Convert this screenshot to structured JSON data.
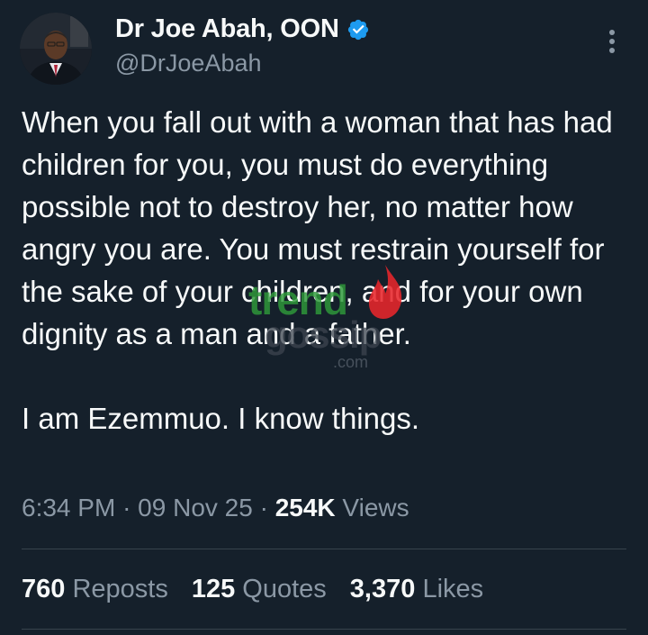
{
  "author": {
    "display_name": "Dr Joe Abah, OON",
    "handle": "@DrJoeAbah",
    "verified": true,
    "avatar_icon": "profile-photo"
  },
  "tweet": {
    "paragraphs": [
      "When you fall out with a woman that has had children for you, you must do everything possible not to destroy her, no matter how angry you are. You must restrain yourself for the sake of your children, and for your own dignity as a man and a father.",
      "I am Ezemmuo. I know things."
    ]
  },
  "meta": {
    "time": "6:34 PM",
    "separator": "·",
    "date": "09 Nov 25",
    "views_count": "254K",
    "views_label": "Views"
  },
  "stats": {
    "reposts_count": "760",
    "reposts_label": "Reposts",
    "quotes_count": "125",
    "quotes_label": "Quotes",
    "likes_count": "3,370",
    "likes_label": "Likes"
  },
  "watermark": {
    "word1": "trend",
    "word2": "gossip",
    "suffix": ".com"
  },
  "colors": {
    "background": "#15202b",
    "primary_text": "#f7f9f9",
    "secondary_text": "#8b98a5",
    "verified_badge": "#1d9bf0",
    "divider": "#38444d"
  }
}
